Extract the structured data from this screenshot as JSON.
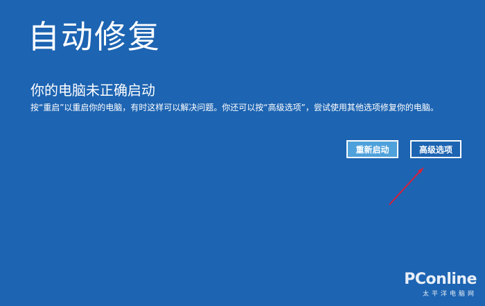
{
  "screen": {
    "title": "自动修复",
    "subtitle": "你的电脑未正确启动",
    "description": "按“重启”以重启你的电脑，有时这样可以解决问题。你还可以按“高级选项”，尝试使用其他选项修复你的电脑。"
  },
  "buttons": {
    "restart_label": "重新启动",
    "advanced_label": "高级选项"
  },
  "watermark": {
    "logo": "PConline",
    "subtitle": "太平洋电脑网"
  },
  "colors": {
    "background": "#1d64b2",
    "restart_button": "#4fa1db",
    "arrow": "#d8203a"
  },
  "icons": {
    "annotation": "arrow-icon"
  }
}
